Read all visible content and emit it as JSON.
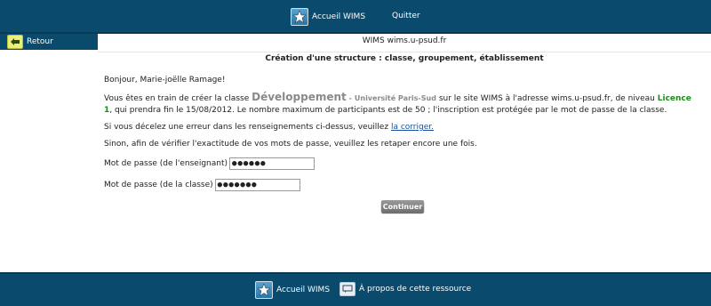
{
  "topbar": {
    "home_label": "Accueil WIMS",
    "quit_label": "Quitter"
  },
  "sidebar": {
    "back_label": "Retour"
  },
  "header": {
    "site_title": "WIMS wims.u-psud.fr",
    "page_title": "Création d'une structure : classe, groupement, établissement"
  },
  "main": {
    "greeting": "Bonjour, Marie-joëlle Ramage!",
    "info": {
      "prefix": "Vous êtes en train de créer la classe",
      "class_name": "Développement",
      "dash": "-",
      "institution": "Université Paris-Sud",
      "middle": "sur le site WIMS à l'adresse wims.u-psud.fr, de niveau",
      "level": "Licence 1",
      "suffix": ", qui prendra fin le 15/08/2012. Le nombre maximum de participants est de 50 ; l'inscription est protégée par le mot de passe de la classe."
    },
    "error_prefix": "Si vous décelez une erreur dans les renseignements ci-dessus, veuillez",
    "error_link": "la corriger.",
    "verify_text": "Sinon, afin de vérifier l'exactitude de vos mots de passe, veuillez les retaper encore une fois.",
    "teacher_label": "Mot de passe (de l'enseignant)",
    "teacher_value": "●●●●●●",
    "class_label": "Mot de passe (de la classe)",
    "class_value": "●●●●●●●",
    "continue_label": "Continuer"
  },
  "footer": {
    "home_label": "Accueil WIMS",
    "about_label": "À propos de cette ressource"
  },
  "colors": {
    "bar": "#0a4a6c",
    "level": "#1f8a1f",
    "link": "#1a4fa0"
  }
}
